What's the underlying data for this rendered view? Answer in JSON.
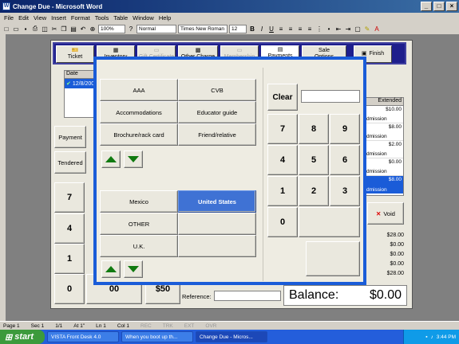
{
  "window": {
    "title": "Change Due - Microsoft Word"
  },
  "menu": [
    "File",
    "Edit",
    "View",
    "Insert",
    "Format",
    "Tools",
    "Table",
    "Window",
    "Help"
  ],
  "toolbar": {
    "zoom": "100%",
    "style": "Normal",
    "font": "Times New Roman",
    "size": "12"
  },
  "tabs": [
    {
      "label1": "",
      "label2": "Ticket",
      "disabled": false
    },
    {
      "label1": "",
      "label2": "Inventory",
      "disabled": false
    },
    {
      "label1": "",
      "label2": "Gift Certificate",
      "disabled": true
    },
    {
      "label1": "",
      "label2": "Other Charge",
      "disabled": false
    },
    {
      "label1": "",
      "label2": "Membership",
      "disabled": true
    },
    {
      "label1": "",
      "label2": "Payments",
      "disabled": false
    },
    {
      "label1": "Sale",
      "label2": "Options",
      "disabled": false
    }
  ],
  "finish_label": "Finish",
  "ticket_list": {
    "col_date": "Date",
    "row_date": "12/8/2003"
  },
  "left_panel": {
    "payment_tab": "Payment",
    "tendered_tab": "Tendered",
    "keys": [
      "7",
      "4",
      "1",
      "0"
    ],
    "key_00": "00",
    "key_50": "$50"
  },
  "reference_label": "Reference:",
  "balance": {
    "label": "Balance:",
    "value": "$0.00"
  },
  "right_list": {
    "col_extended": "Extended",
    "rows": [
      {
        "desc": "dmission",
        "amount": "$10.00",
        "selected": false
      },
      {
        "desc": "dmission",
        "amount": "$8.00",
        "selected": false
      },
      {
        "desc": "dmission",
        "amount": "$2.00",
        "selected": false
      },
      {
        "desc": "dmission",
        "amount": "$0.00",
        "selected": false
      },
      {
        "desc": "dmission",
        "amount": "$8.00",
        "selected": true
      }
    ],
    "void_label": "Void",
    "totals": [
      "$28.00",
      "$0.00",
      "$0.00",
      "$0.00",
      "$28.00"
    ]
  },
  "modal": {
    "source_options": [
      "AAA",
      "CVB",
      "Accommodations",
      "Educator guide",
      "Brochure/rack card",
      "Friend/relative"
    ],
    "countries": [
      "Mexico",
      "United States",
      "OTHER",
      "",
      "U.K.",
      ""
    ],
    "selected_country": "United States",
    "clear_label": "Clear",
    "clear_value": "",
    "keypad": [
      "7",
      "8",
      "9",
      "4",
      "5",
      "6",
      "1",
      "2",
      "3",
      "0"
    ]
  },
  "status": {
    "page": "Page 1",
    "sec": "Sec 1",
    "pages": "1/1",
    "at": "At 1\"",
    "ln": "Ln 1",
    "col": "Col 1",
    "rec": "REC",
    "trk": "TRK",
    "ext": "EXT",
    "ovr": "OVR"
  },
  "taskbar": {
    "start": "start",
    "tasks": [
      "VISTA Front Desk 4.0",
      "When you boot up th...",
      "Change Due - Micros..."
    ],
    "clock": "3:44 PM"
  }
}
